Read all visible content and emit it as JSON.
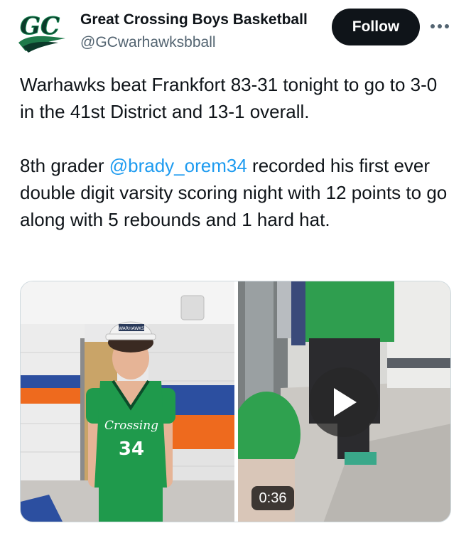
{
  "account": {
    "display_name": "Great Crossing Boys Basketball",
    "handle": "@GCwarhawksbball",
    "avatar_icon": "great-crossing-gc-logo",
    "follow_label": "Follow",
    "more_icon": "more-options-icon"
  },
  "tweet": {
    "paragraph1": "Warhawks beat Frankfort 83-31 tonight to go to 3-0 in the 41st District and 13-1 overall.",
    "paragraph2_before": "8th grader ",
    "mention": "@brady_orem34",
    "paragraph2_after": " recorded his first ever double digit varsity scoring night with 12 points to go along with 5 rebounds and 1 hard hat."
  },
  "media": {
    "photo": {
      "hat_text": "WARHAWKS",
      "jersey_text": "Crossing",
      "jersey_number": "34"
    },
    "video": {
      "duration": "0:36",
      "play_icon": "play-icon"
    }
  },
  "colors": {
    "accent_link": "#1d9bf0",
    "follow_bg": "#0f1419",
    "brand_green": "#1f9a4c"
  }
}
